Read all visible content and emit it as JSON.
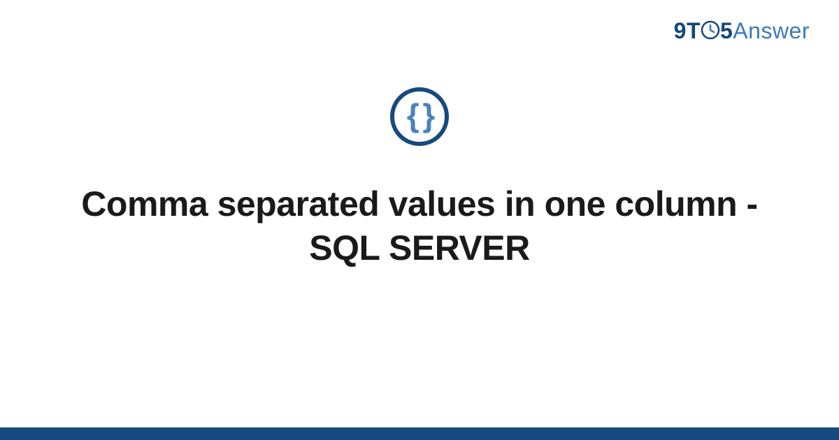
{
  "logo": {
    "part_9t": "9T",
    "part_5": "5",
    "part_answer": "Answer"
  },
  "icon": {
    "braces_text": "{ }"
  },
  "title": "Comma separated values in one column - SQL SERVER",
  "colors": {
    "accent_dark": "#164a7f",
    "accent_light": "#4a82bf",
    "text": "#1a1a1a"
  }
}
